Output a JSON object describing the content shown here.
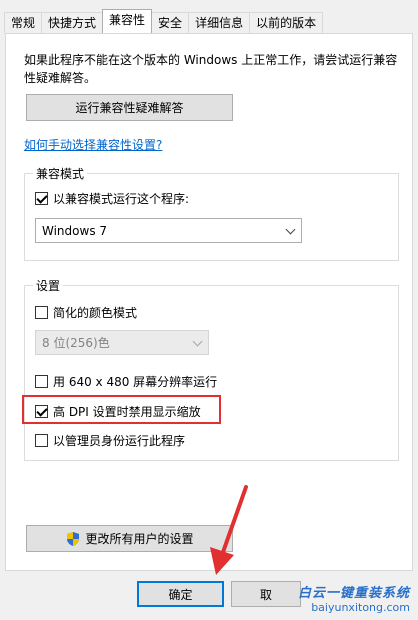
{
  "tabs": [
    {
      "label": "常规"
    },
    {
      "label": "快捷方式"
    },
    {
      "label": "兼容性",
      "active": true
    },
    {
      "label": "安全"
    },
    {
      "label": "详细信息"
    },
    {
      "label": "以前的版本"
    }
  ],
  "intro_text": "如果此程序不能在这个版本的 Windows 上正常工作，请尝试运行兼容性疑难解答。",
  "troubleshoot_button": "运行兼容性疑难解答",
  "manual_link": "如何手动选择兼容性设置?",
  "compat_group": {
    "title": "兼容模式",
    "checkbox_label": "以兼容模式运行这个程序:",
    "checked": true,
    "os_select_value": "Windows 7"
  },
  "settings_group": {
    "title": "设置",
    "reduced_color": {
      "label": "简化的颜色模式",
      "checked": false
    },
    "color_select_value": "8 位(256)色",
    "res_640": {
      "label": "用 640 x 480 屏幕分辨率运行",
      "checked": false
    },
    "high_dpi": {
      "label": "高 DPI 设置时禁用显示缩放",
      "checked": true
    },
    "admin": {
      "label": "以管理员身份运行此程序",
      "checked": false
    }
  },
  "all_users_button": "更改所有用户的设置",
  "footer": {
    "ok_button": "确定",
    "cancel_button": "取"
  },
  "watermark": {
    "top": "白云一键重装系统",
    "bottom": "baiyunxitong.com"
  },
  "colors": {
    "highlight_border": "#e03030",
    "link": "#0066cc",
    "focus_border": "#0078d7"
  }
}
